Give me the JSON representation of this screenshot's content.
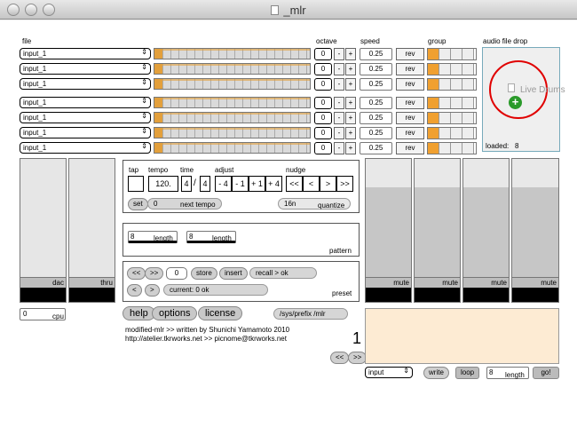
{
  "window": {
    "title": "_mlr"
  },
  "headers": {
    "file": "file",
    "octave": "octave",
    "speed": "speed",
    "group": "group",
    "drop": "audio file drop"
  },
  "tracks": [
    {
      "file": "input_1",
      "octave": "0",
      "speed": "0.25",
      "rev": "rev",
      "group_on": 0
    },
    {
      "file": "input_1",
      "octave": "0",
      "speed": "0.25",
      "rev": "rev",
      "group_on": 0
    },
    {
      "file": "input_1",
      "octave": "0",
      "speed": "0.25",
      "rev": "rev",
      "group_on": 0
    },
    {
      "file": "input_1",
      "octave": "0",
      "speed": "0.25",
      "rev": "rev",
      "group_on": 0
    },
    {
      "file": "input_1",
      "octave": "0",
      "speed": "0.25",
      "rev": "rev",
      "group_on": 0
    },
    {
      "file": "input_1",
      "octave": "0",
      "speed": "0.25",
      "rev": "rev",
      "group_on": 0
    },
    {
      "file": "input_1",
      "octave": "0",
      "speed": "0.25",
      "rev": "rev",
      "group_on": 0
    }
  ],
  "buttons": {
    "minus": "-",
    "plus": "+",
    "arrows": "⇕"
  },
  "drop": {
    "drag_label": "Live Drums",
    "loaded_label": "loaded:",
    "loaded_value": "8"
  },
  "left_faders": [
    {
      "label": "dac"
    },
    {
      "label": "thru"
    }
  ],
  "cpu": {
    "value": "0",
    "label": "cpu"
  },
  "transport": {
    "tap": "tap",
    "tempo": "tempo",
    "time": "time",
    "adjust": "adjust",
    "nudge": "nudge",
    "tempo_value": "120.",
    "time_num": "4",
    "time_sep": "/",
    "time_den": "4",
    "adjust_values": [
      "- 4",
      "- 1",
      "+ 1",
      "+ 4"
    ],
    "nudge_values": [
      "<<",
      "<",
      ">",
      ">>"
    ],
    "set": "set",
    "next_tempo_value": "0",
    "next_tempo_label": "next tempo",
    "quantize_value": "16n",
    "quantize_label": "quantize"
  },
  "pattern": {
    "len1": "8",
    "len2": "8",
    "length_label": "length",
    "label": "pattern"
  },
  "preset": {
    "prev": "<<",
    "next": ">>",
    "num": "0",
    "store": "store",
    "insert": "insert",
    "recall": "recall > ok",
    "left": "<",
    "right": ">",
    "current": "current: 0 ok",
    "label": "preset"
  },
  "right_faders": [
    {
      "label": "mute"
    },
    {
      "label": "mute"
    },
    {
      "label": "mute"
    },
    {
      "label": "mute"
    }
  ],
  "footer": {
    "help": "help",
    "options": "options",
    "license": "license",
    "prefix": "/sys/prefix /mlr",
    "credit1": "modified-mlr >> written by Shunichi Yamamoto  2010",
    "credit2": "http://atelier.tkrworks.net >> picnome@tkrworks.net",
    "page_num": "1",
    "page_prev": "<<",
    "page_next": ">>"
  },
  "rec": {
    "input": "input",
    "write": "write",
    "loop": "loop",
    "len": "8",
    "length_label": "length",
    "go": "go!"
  },
  "colors": {
    "accent": "#f0a030",
    "drop_ring": "#e00000",
    "rec_bg": "#fdebd3"
  }
}
